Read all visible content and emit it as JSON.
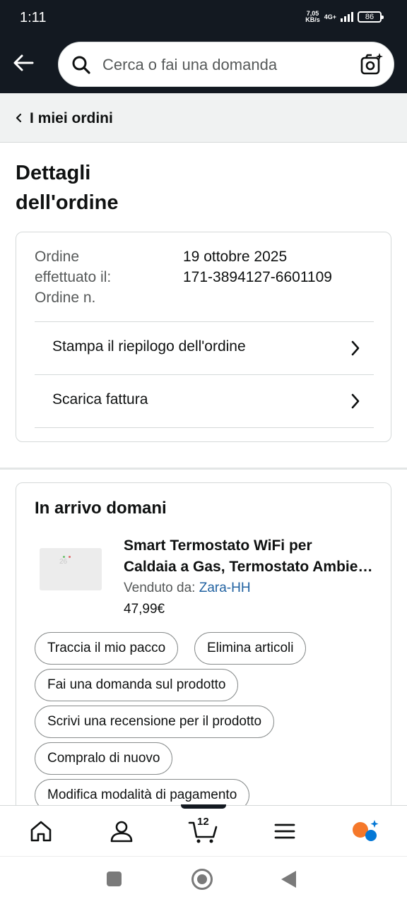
{
  "status_bar": {
    "time": "1:11",
    "net_speed_value": "7,05",
    "net_speed_unit": "KB/s",
    "network_type": "4G+",
    "battery": "86"
  },
  "header": {
    "search_placeholder": "Cerca o fai una domanda"
  },
  "breadcrumb": {
    "label": "I miei ordini"
  },
  "page": {
    "title_line1": "Dettagli",
    "title_line2": "dell'ordine"
  },
  "order_info": {
    "label_placed_line1": "Ordine",
    "label_placed_line2": "effettuato il:",
    "label_number": "Ordine n.",
    "date": "19 ottobre 2025",
    "number": "171-3894127-6601109",
    "links": [
      {
        "label": "Stampa il riepilogo dell'ordine"
      },
      {
        "label": "Scarica fattura"
      }
    ]
  },
  "delivery": {
    "heading": "In arrivo domani",
    "product": {
      "title_line1": "Smart Termostato WiFi per",
      "title_line2": "Caldaia a Gas, Termostato Ambiente Programmabile",
      "seller_label": "Venduto da: ",
      "seller_name": "Zara-HH",
      "price": "47,99€",
      "thumb_display": "26"
    },
    "actions": [
      {
        "label": "Traccia il mio pacco"
      },
      {
        "label": "Elimina articoli"
      },
      {
        "label": "Fai una domanda sul prodotto"
      },
      {
        "label": "Scrivi una recensione per il prodotto"
      },
      {
        "label": "Compralo di nuovo"
      },
      {
        "label": "Modifica modalità di pagamento"
      }
    ]
  },
  "bottom_nav": {
    "cart_count": "12",
    "items": [
      "home-icon",
      "account-icon",
      "cart-icon",
      "menu-icon",
      "rufus-assistant-icon"
    ],
    "accent_color": "#131921"
  },
  "colors": {
    "header_bg": "#131921",
    "link": "#2162a1",
    "rufus_orange": "#f5782a",
    "rufus_blue": "#0578d6"
  }
}
